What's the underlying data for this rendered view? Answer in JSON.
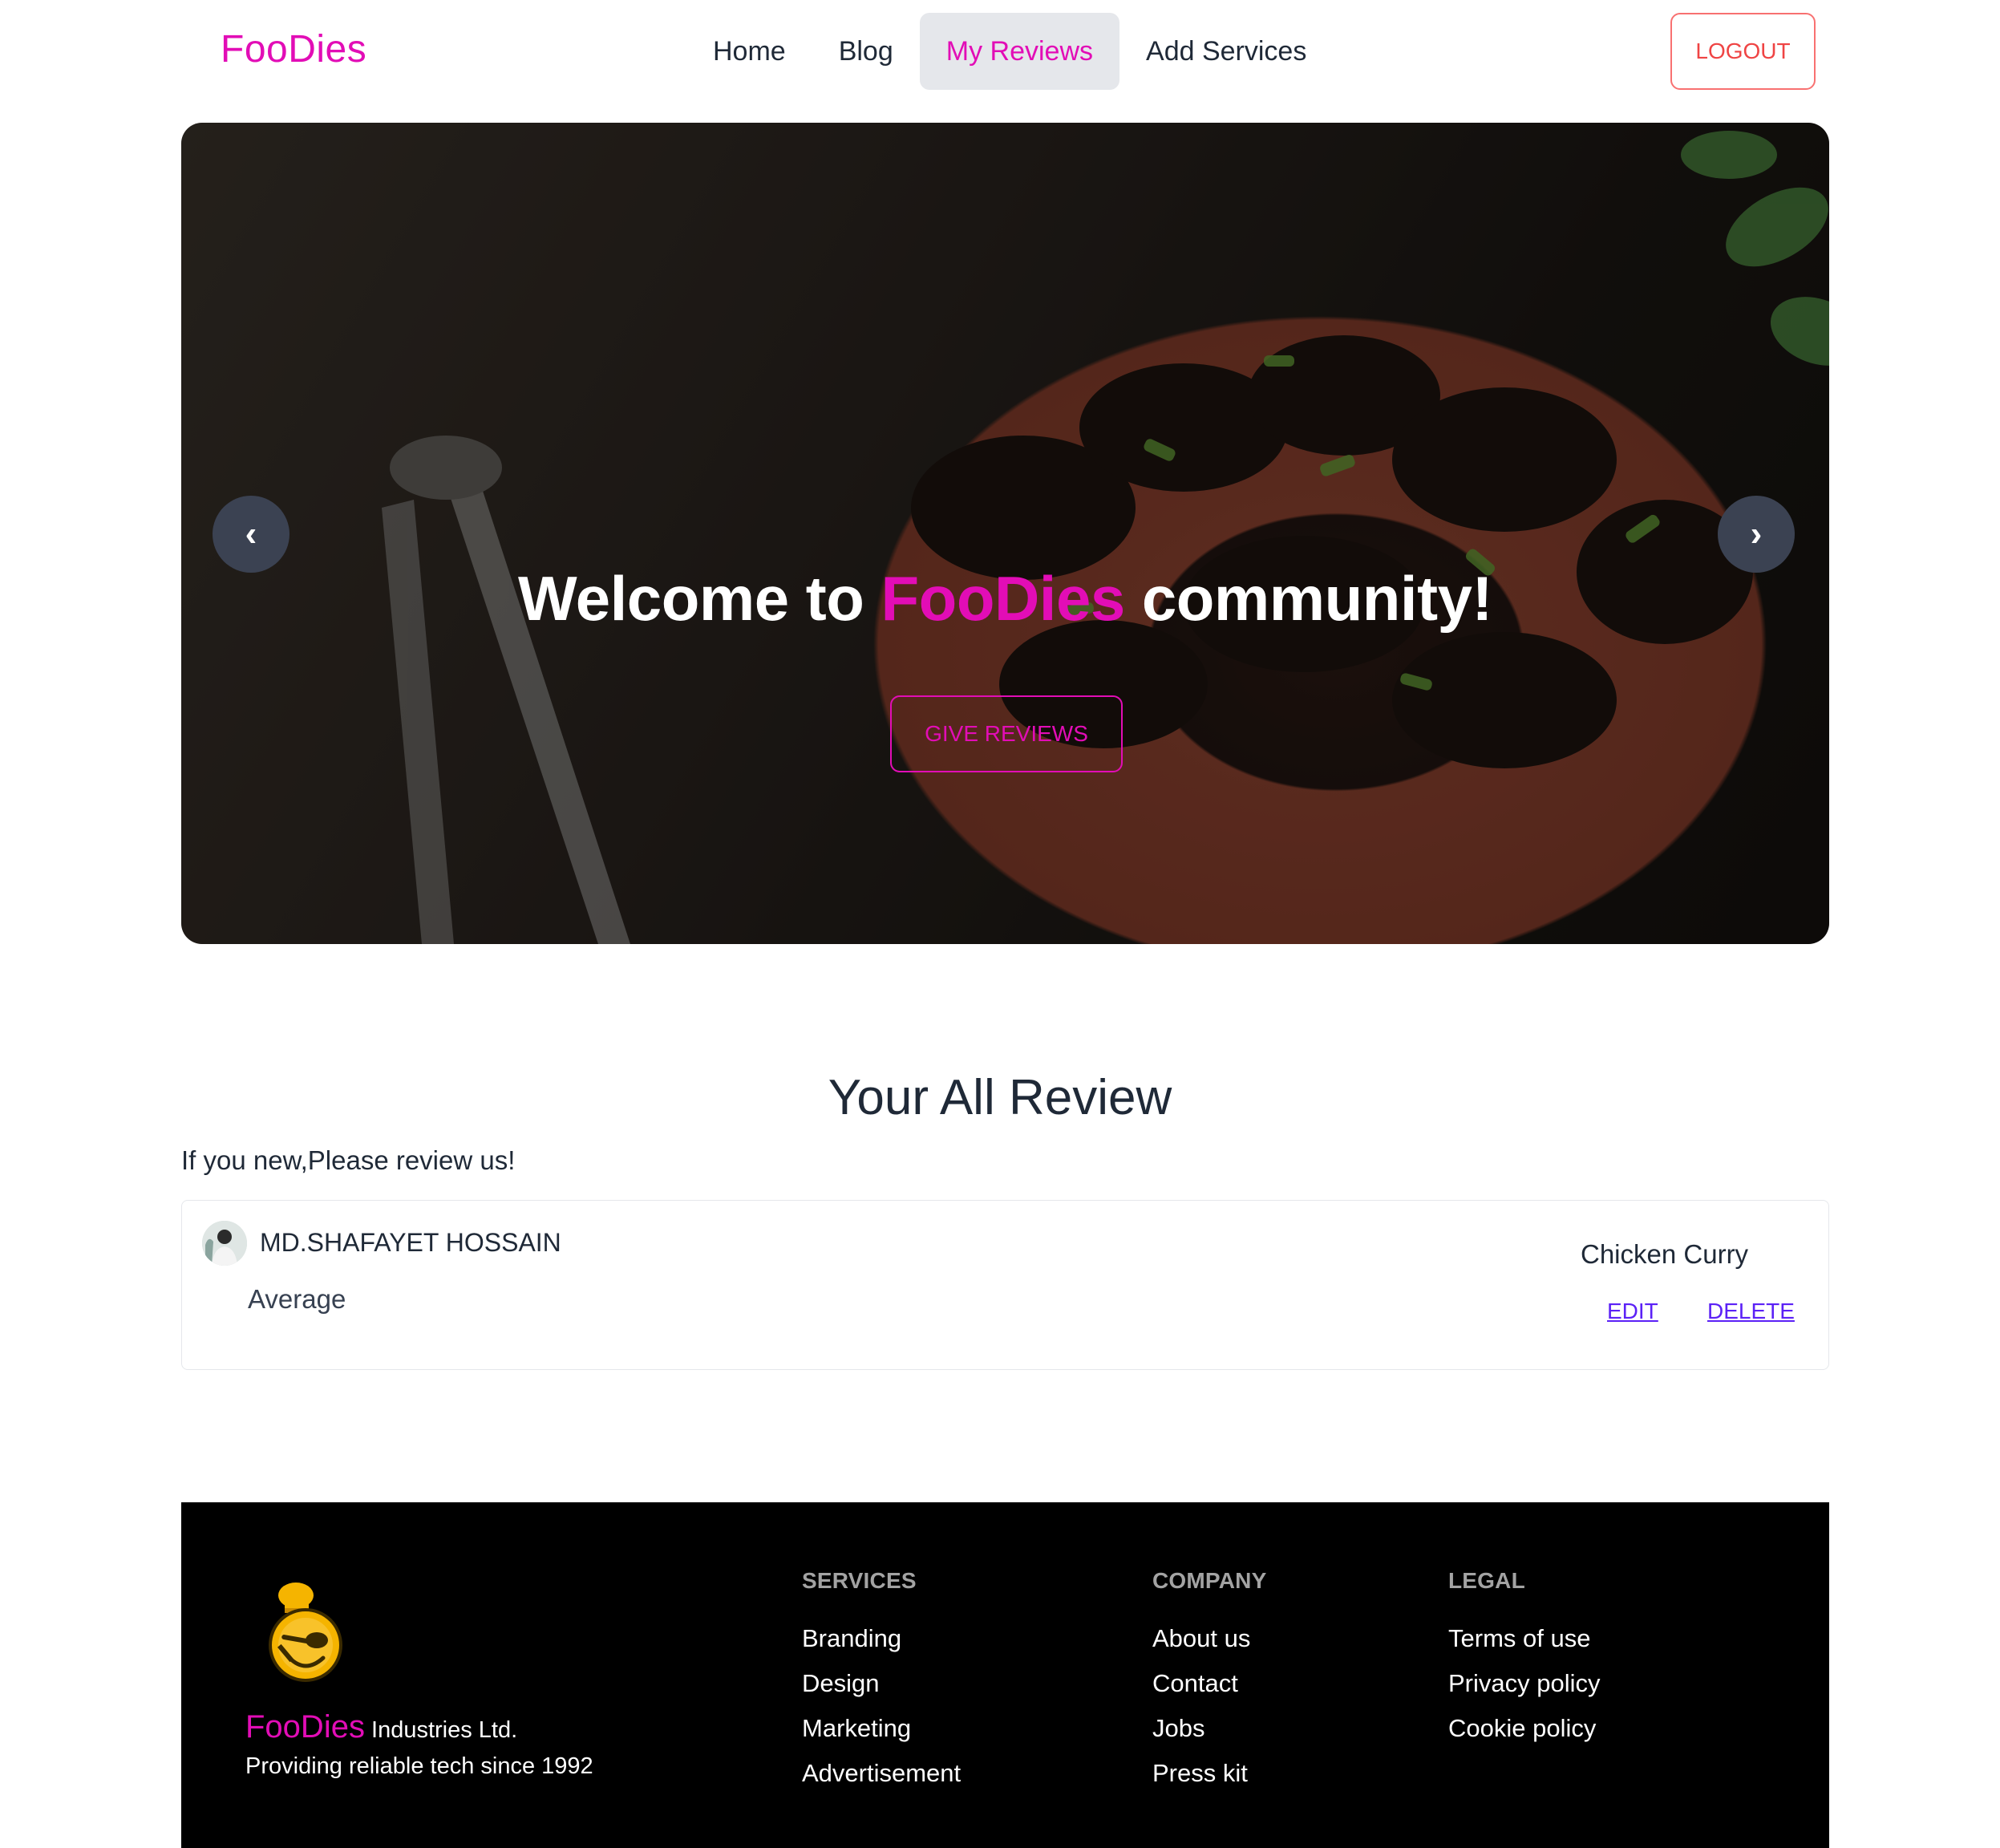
{
  "navbar": {
    "brand": "FooDies",
    "items": [
      {
        "label": "Home"
      },
      {
        "label": "Blog"
      },
      {
        "label": "My Reviews"
      },
      {
        "label": "Add Services"
      }
    ],
    "active_item": "My Reviews",
    "logout_label": "LOGOUT"
  },
  "hero": {
    "title_prefix": "Welcome to ",
    "title_brand": "FooDies",
    "title_suffix": " community!",
    "cta_label": "GIVE REVIEWS",
    "prev_glyph": "‹",
    "next_glyph": "›",
    "prev_icon": "chevron-left-icon",
    "next_icon": "chevron-right-icon"
  },
  "reviews": {
    "title": "Your All Review",
    "subtitle": "If you new,Please review us!",
    "items": [
      {
        "reviewer": "MD.SHAFAYET HOSSAIN",
        "rating": "Average",
        "service": "Chicken Curry",
        "edit_label": "EDIT",
        "delete_label": "DELETE"
      }
    ]
  },
  "footer": {
    "brand": "FooDies",
    "brand_suffix": " Industries Ltd.",
    "tagline": "Providing reliable tech since 1992",
    "columns": [
      {
        "heading": "SERVICES",
        "links": [
          "Branding",
          "Design",
          "Marketing",
          "Advertisement"
        ]
      },
      {
        "heading": "COMPANY",
        "links": [
          "About us",
          "Contact",
          "Jobs",
          "Press kit"
        ]
      },
      {
        "heading": "LEGAL",
        "links": [
          "Terms of use",
          "Privacy policy",
          "Cookie policy"
        ]
      }
    ]
  },
  "colors": {
    "brand": "#e20db6",
    "logout": "#ef4444",
    "link": "#5b21f6",
    "footer_bg": "#000000",
    "nav_active_bg": "#e5e7eb"
  }
}
